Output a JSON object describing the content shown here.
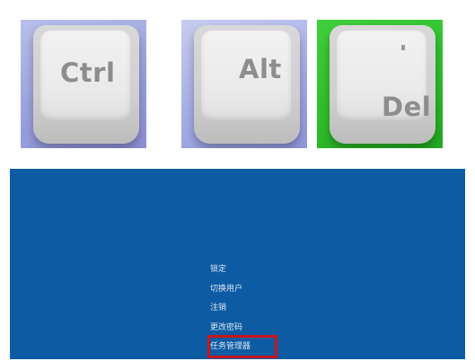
{
  "keys": [
    {
      "label": "Ctrl",
      "icon": "ctrl-key-photo",
      "bg": "#9aa3de"
    },
    {
      "label": "Alt",
      "icon": "alt-key-photo",
      "bg": "#a7aee6"
    },
    {
      "label": "Del",
      "icon": "del-key-photo",
      "bg": "#2ebd2b"
    }
  ],
  "security_screen": {
    "background": "#0d5ba3",
    "menu": [
      "锁定",
      "切换用户",
      "注销",
      "更改密码",
      "任务管理器"
    ],
    "highlighted_item": "任务管理器",
    "highlight_color": "#c8151b"
  }
}
